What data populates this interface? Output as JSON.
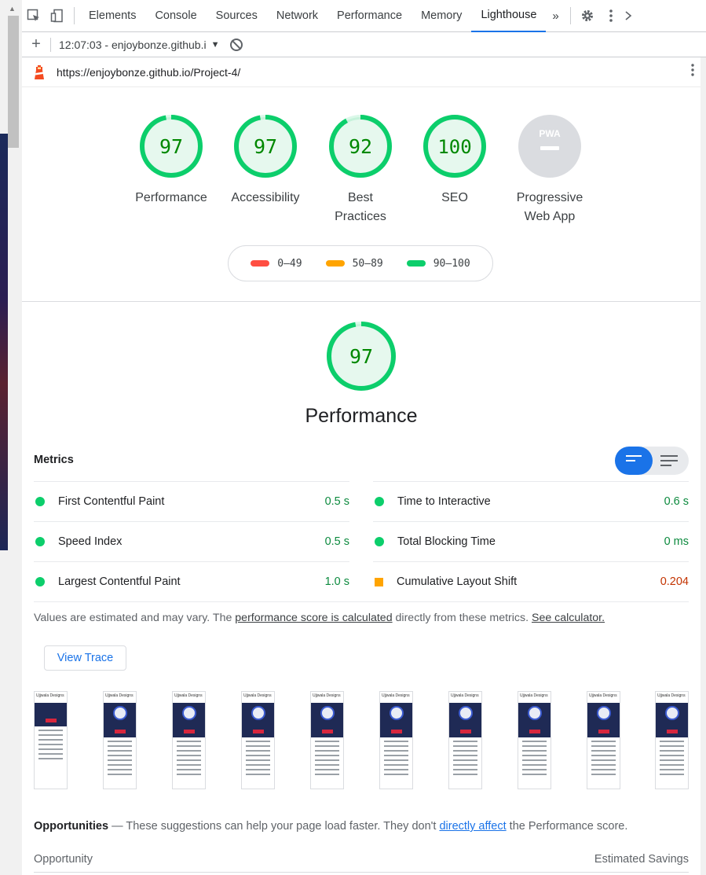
{
  "devtools": {
    "tabs": [
      "Elements",
      "Console",
      "Sources",
      "Network",
      "Performance",
      "Memory",
      "Lighthouse"
    ],
    "active_tab": "Lighthouse",
    "overflow": "»"
  },
  "lighthouse_bar": {
    "report_label": "12:07:03 - enjoybonze.github.i",
    "caret": "▼"
  },
  "url": "https://enjoybonze.github.io/Project-4/",
  "categories": [
    {
      "label": "Performance",
      "score": "97",
      "value": 97
    },
    {
      "label": "Accessibility",
      "score": "97",
      "value": 97
    },
    {
      "label": "Best Practices",
      "score": "92",
      "value": 92
    },
    {
      "label": "SEO",
      "score": "100",
      "value": 100
    },
    {
      "label": "Progressive Web App",
      "badge": "PWA"
    }
  ],
  "legend": [
    {
      "range": "0–49",
      "color": "#f33"
    },
    {
      "range": "50–89",
      "color": "#fa3"
    },
    {
      "range": "90–100",
      "color": "#0c6"
    }
  ],
  "performance": {
    "score": "97",
    "value": 97,
    "title": "Performance"
  },
  "metrics": {
    "header": "Metrics",
    "items": [
      {
        "name": "First Contentful Paint",
        "value": "0.5 s",
        "rating": "pass"
      },
      {
        "name": "Time to Interactive",
        "value": "0.6 s",
        "rating": "pass"
      },
      {
        "name": "Speed Index",
        "value": "0.5 s",
        "rating": "pass"
      },
      {
        "name": "Total Blocking Time",
        "value": "0 ms",
        "rating": "pass"
      },
      {
        "name": "Largest Contentful Paint",
        "value": "1.0 s",
        "rating": "pass"
      },
      {
        "name": "Cumulative Layout Shift",
        "value": "0.204",
        "rating": "average"
      }
    ]
  },
  "note": {
    "prefix": "Values are estimated and may vary. The ",
    "link1": "performance score is calculated",
    "middle": " directly from these metrics. ",
    "link2": "See calculator."
  },
  "view_trace_label": "View Trace",
  "filmstrip_frame_header": "Ujjwala Designs",
  "opportunities": {
    "title": "Opportunities",
    "dash": " — ",
    "text": "These suggestions can help your page load faster. They don't ",
    "link": "directly affect",
    "suffix": " the Performance score.",
    "col_left": "Opportunity",
    "col_right": "Estimated Savings"
  },
  "colors": {
    "pass": "#0cce6b",
    "pass_fill": "#e6f8ee",
    "average": "#ffa400",
    "fail": "#ff4e42",
    "accent": "#1a73e8"
  }
}
